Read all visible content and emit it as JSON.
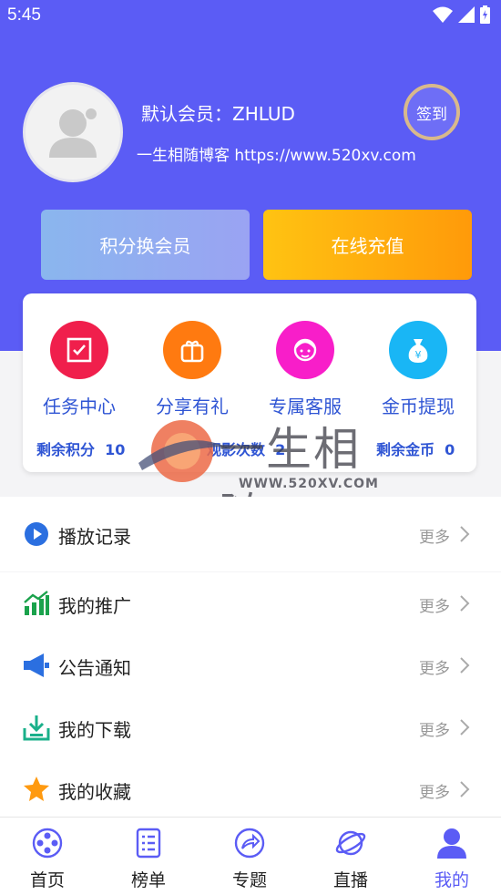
{
  "status_bar": {
    "time": "5:45"
  },
  "profile": {
    "member_name": "默认会员：ZHLUD",
    "blog_line": "一生相随博客 https://www.520xv.com",
    "checkin_label": "签到"
  },
  "actions": {
    "points_exchange_label": "积分换会员",
    "recharge_label": "在线充值"
  },
  "functions": [
    {
      "label": "任务中心",
      "icon": "task-icon",
      "color": "#f01f4c"
    },
    {
      "label": "分享有礼",
      "icon": "gift-icon",
      "color": "#ff7a10"
    },
    {
      "label": "专属客服",
      "icon": "service-icon",
      "color": "#f81ec9"
    },
    {
      "label": "金币提现",
      "icon": "coin-bag-icon",
      "color": "#19b6f5"
    }
  ],
  "stats": {
    "points_label": "剩余积分",
    "points_value": "10",
    "views_label": "观影次数",
    "views_value": "2",
    "coins_label": "剩余金币",
    "coins_value": "0"
  },
  "watermark": {
    "text": "一生相随",
    "url": "WWW.520XV.COM"
  },
  "menu": [
    {
      "title": "播放记录",
      "more": "更多",
      "icon": "play-icon"
    },
    {
      "title": "我的推广",
      "more": "更多",
      "icon": "chart-icon"
    },
    {
      "title": "公告通知",
      "more": "更多",
      "icon": "megaphone-icon"
    },
    {
      "title": "我的下载",
      "more": "更多",
      "icon": "download-icon"
    },
    {
      "title": "我的收藏",
      "more": "更多",
      "icon": "star-icon"
    }
  ],
  "tabs": [
    {
      "label": "首页",
      "icon": "film-reel-icon"
    },
    {
      "label": "榜单",
      "icon": "list-icon"
    },
    {
      "label": "专题",
      "icon": "share-icon"
    },
    {
      "label": "直播",
      "icon": "planet-icon"
    },
    {
      "label": "我的",
      "icon": "user-icon",
      "active": true
    }
  ],
  "colors": {
    "primary": "#5b5cf5",
    "accent_blue": "#2f55d4"
  }
}
